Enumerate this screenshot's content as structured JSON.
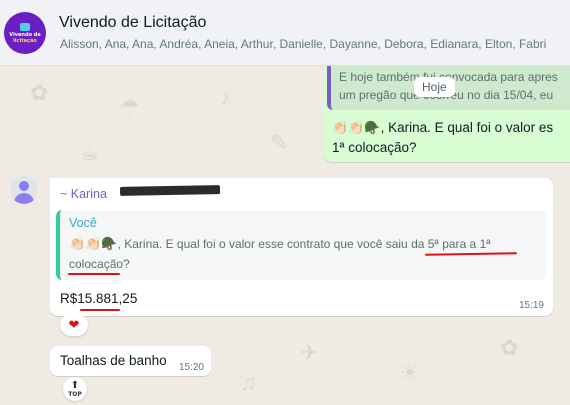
{
  "header": {
    "group_name": "Vivendo de Licitação",
    "members": "Alisson, Ana, Ana, Andréa, Aneia, Arthur, Danielle, Dayanne, Debora, Edianara, Elton, Fabri",
    "avatar_line1": "Vivendo de",
    "avatar_line2": "licitação"
  },
  "date_divider": "Hoje",
  "outgoing": {
    "quote_line1": "E hoje também fui convocada para apres",
    "quote_line2": "um pregão que ocorreu no dia 15/04, eu",
    "message_emojis": "👏🏻👏🏻🪖",
    "message_text": ", Karina. E qual foi o valor es",
    "message_line2": "1ª colocação?"
  },
  "incoming": {
    "sender": "~ Karina",
    "quote_author": "Você",
    "quote_emojis": "👏🏻👏🏻🪖",
    "quote_part1": ", Karina. E qual foi o valor esse contrato que você ",
    "quote_underlined1": "saiu da 5ª para a",
    "quote_part2": " 1ª",
    "quote_underlined2": "colocação",
    "quote_end": "?",
    "value_prefix": "R$",
    "value_amount": "15.881,25",
    "time": "15:19",
    "reaction": "❤"
  },
  "incoming2": {
    "text": "Toalhas de banho",
    "time": "15:20",
    "badge_label": "TOP",
    "badge_arrow": "⬆"
  }
}
